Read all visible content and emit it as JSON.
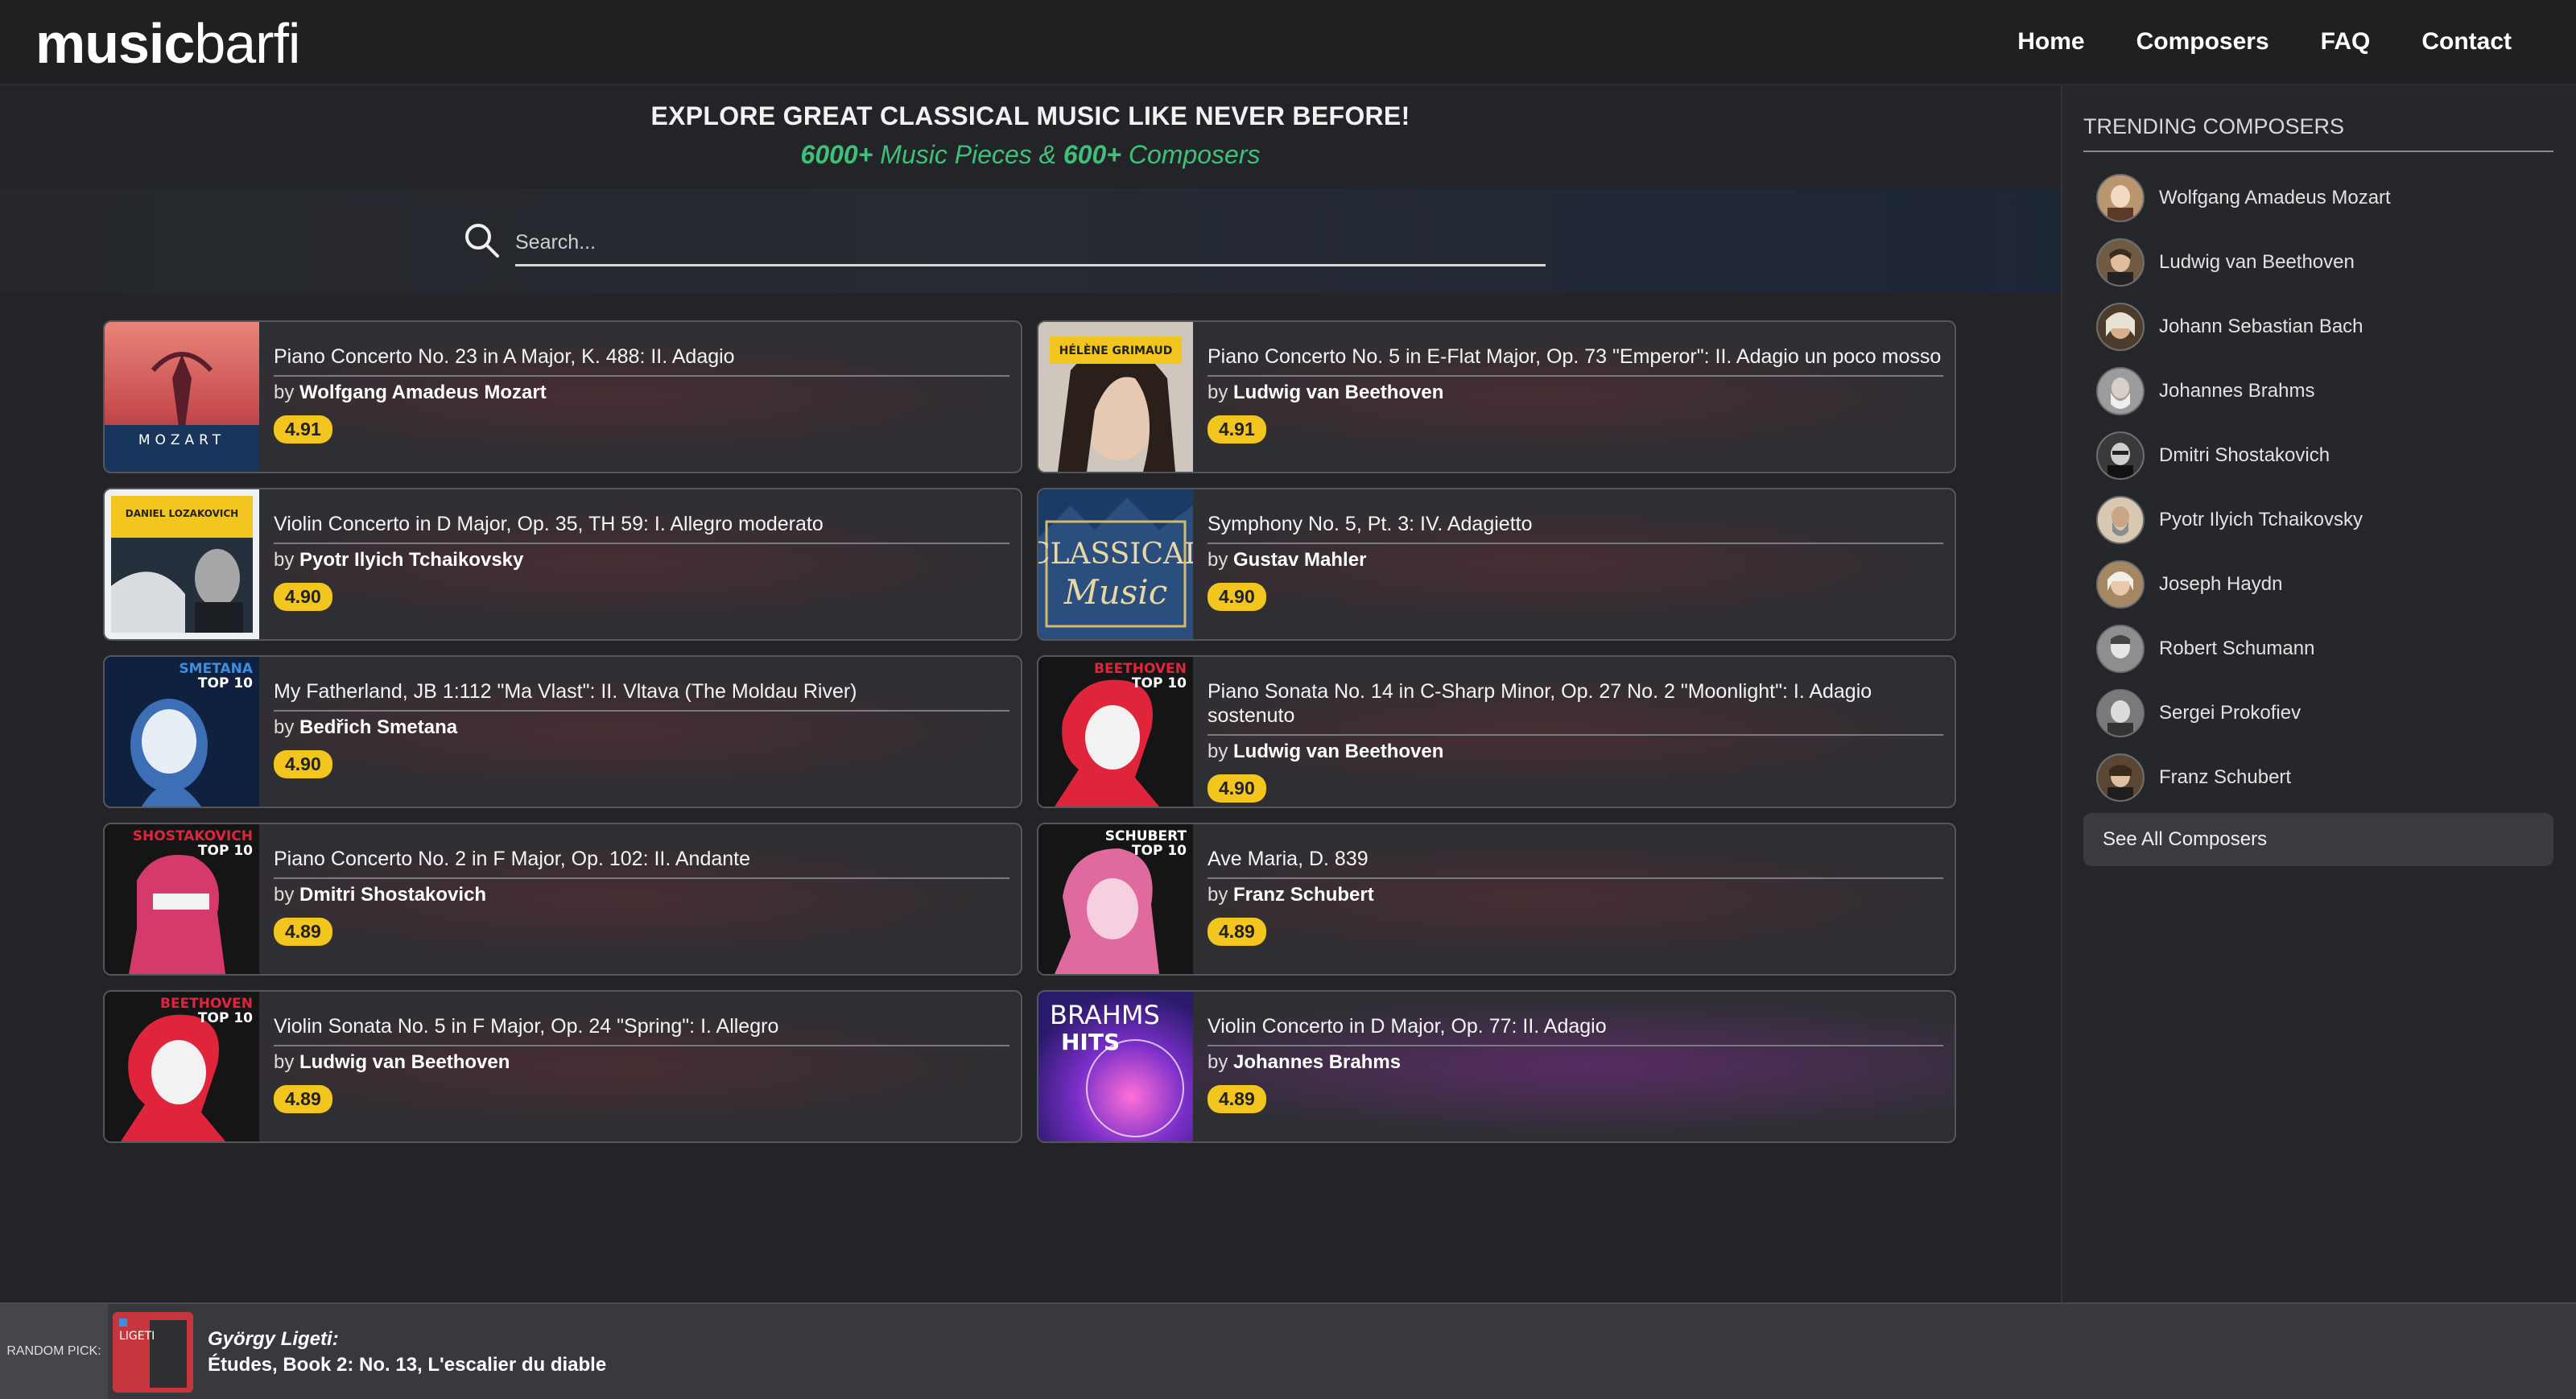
{
  "brand": {
    "logo_bold": "music",
    "logo_light": "barfi"
  },
  "nav": {
    "home": "Home",
    "composers": "Composers",
    "faq": "FAQ",
    "contact": "Contact"
  },
  "hero": {
    "title": "EXPLORE GREAT CLASSICAL MUSIC LIKE NEVER BEFORE!",
    "pieces_count": "6000+",
    "pieces_text": " Music Pieces & ",
    "composers_count": "600+",
    "composers_text": " Composers"
  },
  "search": {
    "placeholder": "Search..."
  },
  "cards": [
    {
      "title": "Piano Concerto No. 23 in A Major, K. 488: II. Adagio",
      "by": "by ",
      "composer": "Wolfgang Amadeus Mozart",
      "rating": "4.91",
      "thumb_text": "MOZART"
    },
    {
      "title": "Piano Concerto No. 5 in E-Flat Major, Op. 73 \"Emperor\": II. Adagio un poco mosso",
      "by": "by ",
      "composer": "Ludwig van Beethoven",
      "rating": "4.91",
      "thumb_text": "HÉLÈNE GRIMAUD"
    },
    {
      "title": "Violin Concerto in D Major, Op. 35, TH 59: I. Allegro moderato",
      "by": "by ",
      "composer": "Pyotr Ilyich Tchaikovsky",
      "rating": "4.90",
      "thumb_text": "DANIEL LOZAKOVICH"
    },
    {
      "title": "Symphony No. 5, Pt. 3: IV. Adagietto",
      "by": "by ",
      "composer": "Gustav Mahler",
      "rating": "4.90",
      "thumb_text": "CLASSICAL",
      "thumb_text2": "Music"
    },
    {
      "title": "My Fatherland, JB 1:112 \"Ma Vlast\": II. Vltava (The Moldau River)",
      "by": "by ",
      "composer": "Bedřich Smetana",
      "rating": "4.90",
      "thumb_text": "SMETANA",
      "thumb_text2": "TOP 10"
    },
    {
      "title": "Piano Sonata No. 14 in C-Sharp Minor, Op. 27 No. 2 \"Moonlight\": I. Adagio sostenuto",
      "by": "by ",
      "composer": "Ludwig van Beethoven",
      "rating": "4.90",
      "thumb_text": "BEETHOVEN",
      "thumb_text2": "TOP 10"
    },
    {
      "title": "Piano Concerto No. 2 in F Major, Op. 102: II. Andante",
      "by": "by ",
      "composer": "Dmitri Shostakovich",
      "rating": "4.89",
      "thumb_text": "SHOSTAKOVICH",
      "thumb_text2": "TOP 10"
    },
    {
      "title": "Ave Maria, D. 839",
      "by": "by ",
      "composer": "Franz Schubert",
      "rating": "4.89",
      "thumb_text": "SCHUBERT",
      "thumb_text2": "TOP 10"
    },
    {
      "title": "Violin Sonata No. 5 in F Major, Op. 24 \"Spring\": I. Allegro",
      "by": "by ",
      "composer": "Ludwig van Beethoven",
      "rating": "4.89",
      "thumb_text": "BEETHOVEN",
      "thumb_text2": "TOP 10"
    },
    {
      "title": "Violin Concerto in D Major, Op. 77: II. Adagio",
      "by": "by ",
      "composer": "Johannes Brahms",
      "rating": "4.89",
      "thumb_text": "BRAHMS",
      "thumb_text2": "HITS"
    }
  ],
  "sidebar": {
    "title": "TRENDING COMPOSERS",
    "composers": [
      "Wolfgang Amadeus Mozart",
      "Ludwig van Beethoven",
      "Johann Sebastian Bach",
      "Johannes Brahms",
      "Dmitri Shostakovich",
      "Pyotr Ilyich Tchaikovsky",
      "Joseph Haydn",
      "Robert Schumann",
      "Sergei Prokofiev",
      "Franz Schubert"
    ],
    "see_all": "See All Composers"
  },
  "footer": {
    "label": "RANDOM PICK:",
    "composer": "György Ligeti:",
    "piece": "Études, Book 2: No. 13, L'escalier du diable",
    "thumb_text": "LIGETI"
  },
  "colors": {
    "accent_green": "#3fc07a",
    "rating_yellow": "#f2c61f",
    "thumb_red": "#e0243b"
  }
}
